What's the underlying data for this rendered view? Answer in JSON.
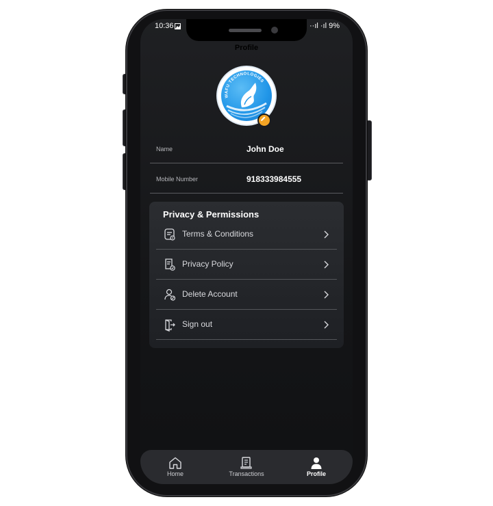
{
  "status_bar": {
    "time": "10:36",
    "right": "··ıl ·ıl 9%"
  },
  "header": {
    "title": "Profile"
  },
  "profile": {
    "avatar_text": "WAFU TECHNOLOGIES",
    "name_label": "Name",
    "name_value": "John Doe",
    "mobile_label": "Mobile Number",
    "mobile_value": "918333984555"
  },
  "privacy_card": {
    "title": "Privacy & Permissions",
    "items": [
      {
        "label": "Terms & Conditions",
        "icon": "terms-icon"
      },
      {
        "label": "Privacy Policy",
        "icon": "privacy-policy-icon"
      },
      {
        "label": "Delete Account",
        "icon": "delete-account-icon"
      },
      {
        "label": "Sign out",
        "icon": "sign-out-icon"
      }
    ]
  },
  "bottom_nav": {
    "items": [
      {
        "label": "Home",
        "icon": "home-icon",
        "active": false
      },
      {
        "label": "Transactions",
        "icon": "transactions-icon",
        "active": false
      },
      {
        "label": "Profile",
        "icon": "profile-icon",
        "active": true
      }
    ]
  },
  "colors": {
    "background": "#151618",
    "card": "#26282c",
    "accent_badge": "#f4a424",
    "logo_blue": "#2196e8",
    "text": "#ffffff",
    "muted_text": "#b7b8bc"
  }
}
